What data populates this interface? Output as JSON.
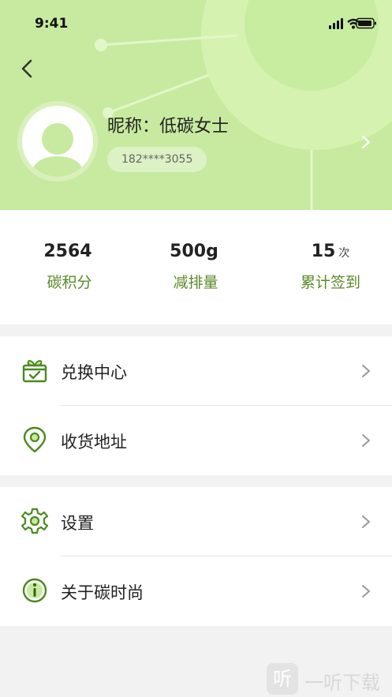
{
  "status_bar": {
    "time": "9:41"
  },
  "profile": {
    "nickname": "昵称：低碳女士",
    "phone": "182****3055"
  },
  "stats": [
    {
      "value": "2564",
      "unit": "",
      "label": "碳积分"
    },
    {
      "value": "500g",
      "unit": "",
      "label": "减排量"
    },
    {
      "value": "15",
      "unit": "次",
      "label": "累计签到"
    }
  ],
  "menu_group_1": [
    {
      "label": "兑换中心",
      "icon": "gift-box-icon"
    },
    {
      "label": "收货地址",
      "icon": "location-pin-icon"
    }
  ],
  "menu_group_2": [
    {
      "label": "设置",
      "icon": "gear-icon"
    },
    {
      "label": "关于碳时尚",
      "icon": "info-icon"
    }
  ],
  "watermark": {
    "glyph": "听",
    "text": "一听下载"
  },
  "colors": {
    "header_bg": "#c8eaa0",
    "accent_green": "#5a8a2a",
    "icon_green": "#4a8a1f"
  }
}
